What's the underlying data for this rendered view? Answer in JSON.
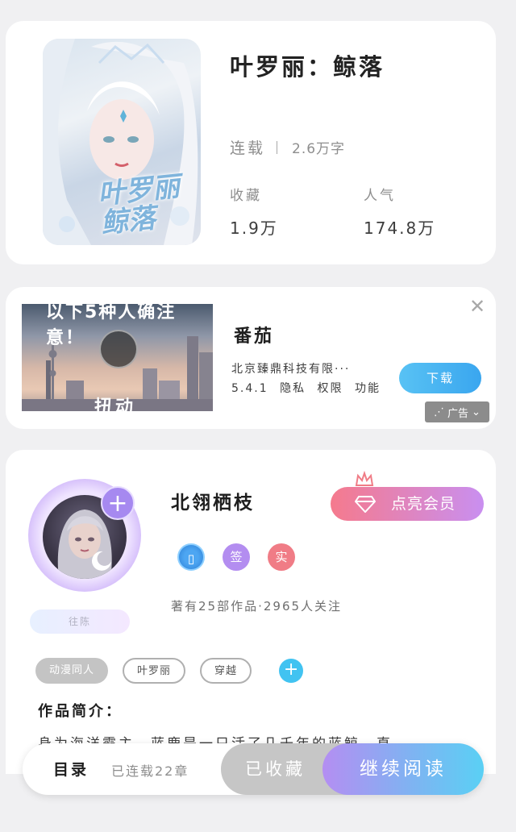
{
  "book": {
    "cover_art_text": "叶罗丽鲸落",
    "title": "叶罗丽：鲸落",
    "status": "连载",
    "word_count": "2.6万字",
    "favorites_label": "收藏",
    "favorites_value": "1.9万",
    "popularity_label": "人气",
    "popularity_value": "174.8万"
  },
  "ad": {
    "video_top_text": "以下5种人确注意！",
    "video_bottom_text": "扭动",
    "app_name": "番茄",
    "company": "北京臻鼎科技有限···",
    "version": "5.4.1",
    "privacy": "隐私",
    "permissions": "权限",
    "functions": "功能",
    "download_label": "下载",
    "badge_label": "广告",
    "close_icon": "close-icon"
  },
  "author": {
    "name": "北翎栖枝",
    "vip_label": "点亮会员",
    "badges": [
      "签",
      "实"
    ],
    "stats": "著有25部作品·2965人关注",
    "tag_label": "往陈"
  },
  "tags": [
    "动漫同人",
    "叶罗丽",
    "穿越"
  ],
  "intro": {
    "title": "作品简介：",
    "text": "身为海洋霸主，蓝鹿是一只活了几千年的蓝鲸，直"
  },
  "bottom_bar": {
    "toc_label": "目录",
    "chapter_count": "已连载22章",
    "collected_label": "已收藏",
    "continue_label": "继续阅读"
  },
  "colors": {
    "accent_purple": "#b48ef2",
    "accent_blue": "#5ad0f4",
    "download_blue": "#3aa6ef",
    "vip_pink": "#f57a8d"
  }
}
